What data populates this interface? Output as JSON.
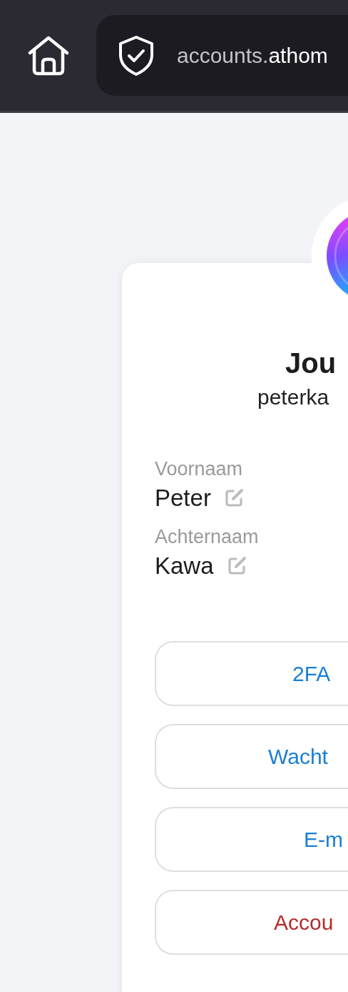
{
  "browser_bar": {
    "url": {
      "subdomain": "accounts.",
      "domain": "athom"
    }
  },
  "profile": {
    "title": "Jou",
    "username": "peterka"
  },
  "fields": [
    {
      "label": "Voornaam",
      "value": "Peter"
    },
    {
      "label": "Achternaam",
      "value": "Kawa"
    }
  ],
  "buttons": [
    {
      "label": "2FA",
      "kind": "normal"
    },
    {
      "label": "Wacht",
      "kind": "normal"
    },
    {
      "label": "E-m",
      "kind": "normal"
    },
    {
      "label": "Accou",
      "kind": "danger"
    }
  ]
}
